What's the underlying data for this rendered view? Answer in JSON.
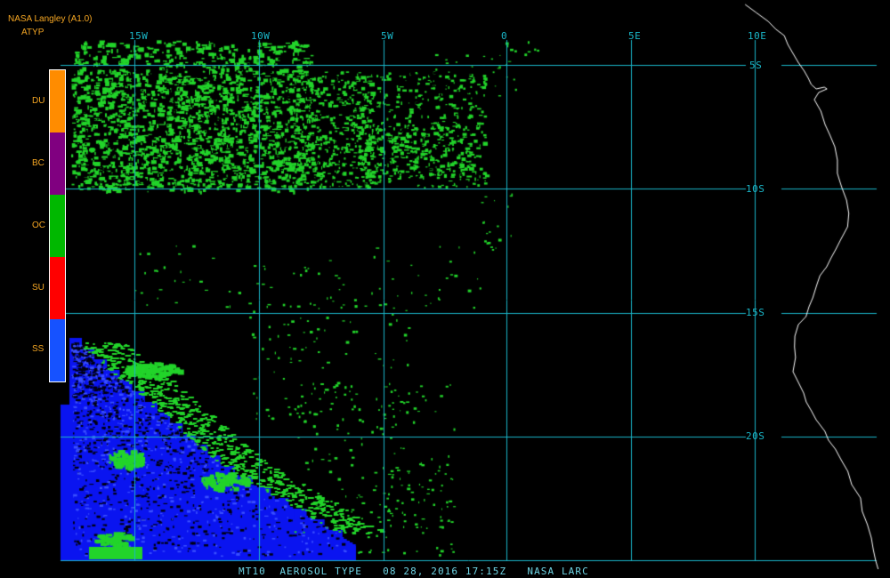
{
  "header": {
    "title": "NASA Langley (A1.0)",
    "product": "ATYP"
  },
  "legend": {
    "entries": [
      {
        "code": "DU",
        "color": "#ff8c00"
      },
      {
        "code": "BC",
        "color": "#800080"
      },
      {
        "code": "OC",
        "color": "#00b800"
      },
      {
        "code": "SU",
        "color": "#ff0000"
      },
      {
        "code": "SS",
        "color": "#1652ff"
      }
    ]
  },
  "map": {
    "background": "#000000",
    "grid_color": "#1ab6c8",
    "coast_color": "#ffffff",
    "longitude_labels": [
      "15W",
      "10W",
      "5W",
      "0",
      "5E",
      "10E"
    ],
    "latitude_labels": [
      "5S",
      "10S",
      "15S",
      "20S"
    ],
    "aerosol_colors": {
      "OC": "#22d42a",
      "SS": "#0a14f0"
    }
  },
  "footer": {
    "caption": "MT10  AEROSOL TYPE   08 28, 2016 17:15Z   NASA LARC"
  }
}
